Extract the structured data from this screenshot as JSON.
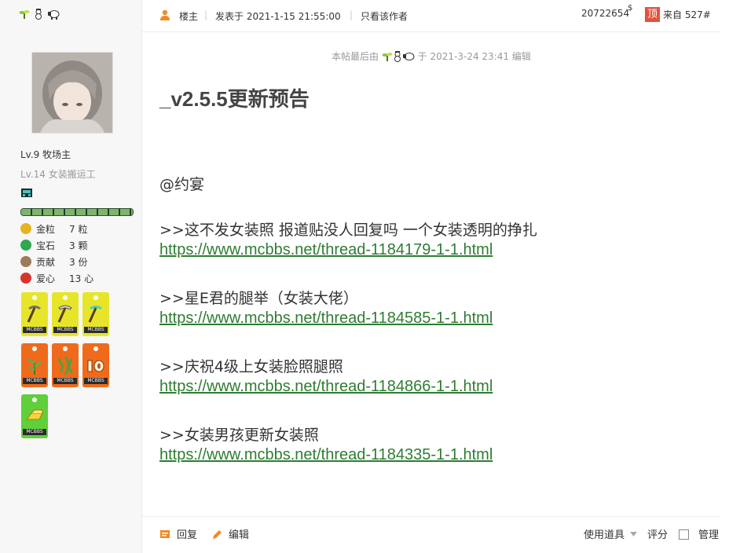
{
  "sidebar": {
    "level_primary": "Lv.9 牧场主",
    "level_secondary": "Lv.14 女装搬运工",
    "stats": [
      {
        "icon": "gold-nugget-icon",
        "label": "金粒",
        "value": "7 粒",
        "color": "#e6b422"
      },
      {
        "icon": "emerald-icon",
        "label": "宝石",
        "value": "3 颗",
        "color": "#2fa84f"
      },
      {
        "icon": "contribution-icon",
        "label": "贡献",
        "value": "3 份",
        "color": "#9b7b5a"
      },
      {
        "icon": "apple-heart-icon",
        "label": "爱心",
        "value": "13 心",
        "color": "#d9342b"
      }
    ],
    "medal_tag": "MCBBS",
    "hp_fraction": 1.0
  },
  "post_header": {
    "floor_owner": "楼主",
    "posted_at": "发表于 2021-1-15 21:55:00",
    "only_author": "只看该作者",
    "post_number": "20722654",
    "currency_mark": "$",
    "top_label": "顶",
    "from_floor": "来自 527#"
  },
  "post": {
    "edited_prefix": "本帖最后由",
    "edited_suffix": "于 2021-3-24 23:41 编辑",
    "title": "_v2.5.5更新预告",
    "mention": "@约宴",
    "entries": [
      {
        "text": ">>这不发女装照 报道贴没人回复吗 一个女装透明的挣扎",
        "link": "https://www.mcbbs.net/thread-1184179-1-1.html"
      },
      {
        "text": ">>星E君的腿举（女装大佬）",
        "link": "https://www.mcbbs.net/thread-1184585-1-1.html"
      },
      {
        "text": ">>庆祝4级上女装脸照腿照",
        "link": "https://www.mcbbs.net/thread-1184866-1-1.html"
      },
      {
        "text": ">>女装男孩更新女装照",
        "link": "https://www.mcbbs.net/thread-1184335-1-1.html"
      }
    ]
  },
  "footer": {
    "reply": "回复",
    "edit": "编辑",
    "use_item": "使用道具",
    "rate": "评分",
    "manage": "管理"
  },
  "colors": {
    "accent_orange": "#f08a24",
    "link_green": "#2e7d32",
    "top_red": "#e0533c"
  }
}
